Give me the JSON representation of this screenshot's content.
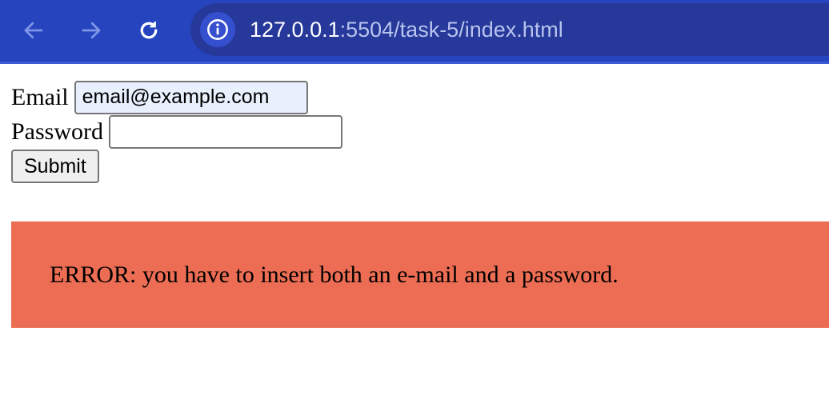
{
  "browser": {
    "url_host": "127.0.0.1",
    "url_rest": ":5504/task-5/index.html",
    "icons": {
      "back": "arrow-left-icon",
      "forward": "arrow-right-icon",
      "reload": "reload-icon",
      "info": "info-icon"
    },
    "colors": {
      "toolbar": "#2544be",
      "address_bar": "#26389a"
    }
  },
  "form": {
    "email_label": "Email",
    "email_value": "email@example.com",
    "password_label": "Password",
    "password_value": "",
    "submit_label": "Submit"
  },
  "error": {
    "message": "ERROR: you have to insert both an e-mail and a password.",
    "background": "#ec6d53"
  }
}
